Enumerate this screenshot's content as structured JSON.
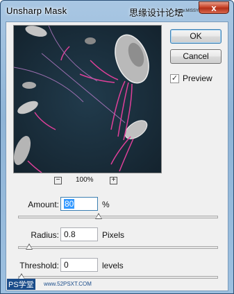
{
  "window": {
    "title": "Unsharp Mask",
    "watermark": "思缘设计论坛",
    "watermark_url": "www.MISSYUAN.COM",
    "close_label": "x"
  },
  "buttons": {
    "ok": "OK",
    "cancel": "Cancel"
  },
  "preview": {
    "label": "Preview",
    "checked": true,
    "zoom": "100%",
    "zoom_out_icon": "minus",
    "zoom_in_icon": "plus"
  },
  "amount": {
    "label": "Amount:",
    "value": "80",
    "unit": "%",
    "slider_fraction": 0.4
  },
  "radius": {
    "label": "Radius:",
    "value": "0.8",
    "unit": "Pixels",
    "slider_fraction": 0.04
  },
  "threshold": {
    "label": "Threshold:",
    "value": "0",
    "unit": "levels",
    "slider_fraction": 0.0
  },
  "footer_watermark": {
    "logo": "PS学堂",
    "url": "www.52PSXT.COM"
  }
}
